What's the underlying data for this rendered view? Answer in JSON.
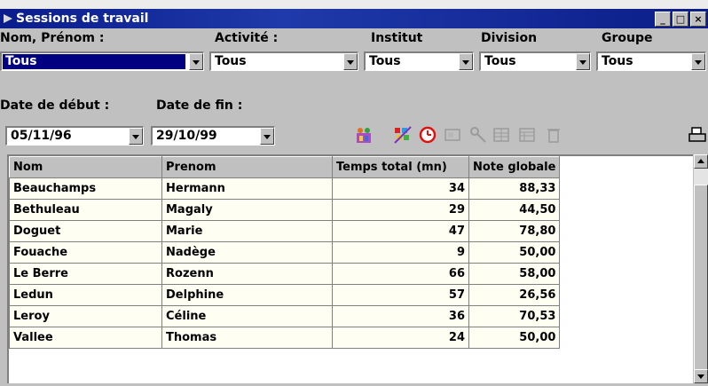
{
  "window": {
    "title": "Sessions de travail",
    "minimize": "_",
    "maximize": "□",
    "close": "×"
  },
  "filters": {
    "nom_label": "Nom, Prénom :",
    "nom_value": "Tous",
    "activite_label": "Activité :",
    "activite_value": "Tous",
    "institut_label": "Institut",
    "institut_value": "Tous",
    "division_label": "Division",
    "division_value": "Tous",
    "groupe_label": "Groupe",
    "groupe_value": "Tous",
    "date_debut_label": "Date de début :",
    "date_debut_value": "05/11/96",
    "date_fin_label": "Date de fin :",
    "date_fin_value": "29/10/99"
  },
  "toolbar": {
    "icons": [
      "people-icon",
      "chart-icon",
      "clock-icon",
      "grid-icon",
      "key-icon",
      "table-icon",
      "layout-icon",
      "trash-icon",
      "print-icon"
    ]
  },
  "table": {
    "columns": [
      "Nom",
      "Prenom",
      "Temps total (mn)",
      "Note globale"
    ],
    "rows": [
      [
        "Beauchamps",
        "Hermann",
        "34",
        "88,33"
      ],
      [
        "Bethuleau",
        "Magaly",
        "29",
        "44,50"
      ],
      [
        "Doguet",
        "Marie",
        "47",
        "78,80"
      ],
      [
        "Fouache",
        "Nadège",
        "9",
        "50,00"
      ],
      [
        "Le Berre",
        "Rozenn",
        "66",
        "58,00"
      ],
      [
        "Ledun",
        "Delphine",
        "57",
        "26,56"
      ],
      [
        "Leroy",
        "Céline",
        "36",
        "70,53"
      ],
      [
        "Vallee",
        "Thomas",
        "24",
        "50,00"
      ]
    ]
  },
  "colors": {
    "titlebar": "#0a1c8c",
    "selection": "#000080",
    "cell_background": "#fefef2"
  }
}
